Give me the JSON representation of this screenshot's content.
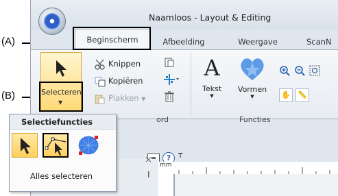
{
  "callouts": {
    "a": "(A)",
    "b": "(B)"
  },
  "window": {
    "title": "Naamloos - Layout & Editing"
  },
  "tabs": [
    {
      "label": "Beginscherm",
      "selected": true
    },
    {
      "label": "Afbeelding"
    },
    {
      "label": "Weergave"
    },
    {
      "label": "ScanN"
    }
  ],
  "ribbon": {
    "select_button": {
      "label": "Selecteren",
      "icon": "arrow-pointer-icon"
    },
    "clipboard": {
      "cut": "Knippen",
      "copy": "Kopiëren",
      "paste": "Plakken",
      "group_label": "ord"
    },
    "functions": {
      "text": "Tekst",
      "shapes": "Vormen",
      "group_label": "Functies"
    }
  },
  "dropdown": {
    "header": "Selectiefuncties",
    "select_all": "Alles selecteren",
    "items": [
      "pointer-select-icon",
      "point-edit-select-icon",
      "circle-select-icon"
    ]
  },
  "quickbar": {
    "help": "?"
  },
  "ruler": {
    "unit": "mm"
  },
  "colors": {
    "highlight": "#ffd978",
    "accent_blue": "#2e5fc9",
    "heart_blue": "#5d9be6"
  }
}
